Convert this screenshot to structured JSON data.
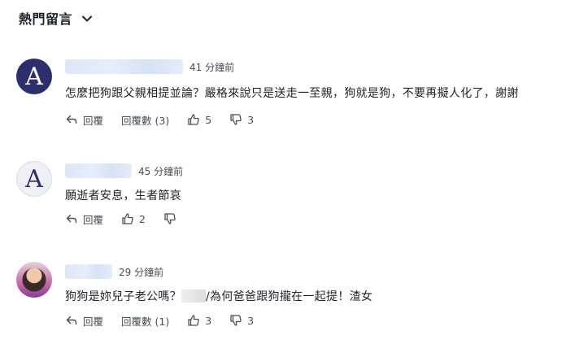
{
  "header": {
    "title": "熱門留言"
  },
  "comments": [
    {
      "time": "41 分鐘前",
      "text": "怎麼把狗跟父親相提並論？嚴格來說只是送走一至親，狗就是狗，不要再擬人化了，謝謝",
      "reply_label": "回覆",
      "replies_label": "回覆數 (3)",
      "likes": "5",
      "dislikes": "3"
    },
    {
      "time": "45 分鐘前",
      "text": "願逝者安息，生者節哀",
      "reply_label": "回覆",
      "likes": "2"
    },
    {
      "time": "29 分鐘前",
      "text_before": "狗狗是妳兒子老公嗎？",
      "text_after": "/為何爸爸跟狗攏在一起提！渣女",
      "reply_label": "回覆",
      "replies_label": "回覆數 (1)",
      "likes": "3",
      "dislikes": "3"
    }
  ],
  "avatars": {
    "c1_letter": "A",
    "c2_letter": "A"
  },
  "colors": {
    "text": "#1d2228",
    "muted": "#464e56",
    "avatar_dark": "#2c2e6e"
  },
  "icons": [
    "chevron-down-icon",
    "reply-icon",
    "thumbs-up-icon",
    "thumbs-down-icon"
  ]
}
